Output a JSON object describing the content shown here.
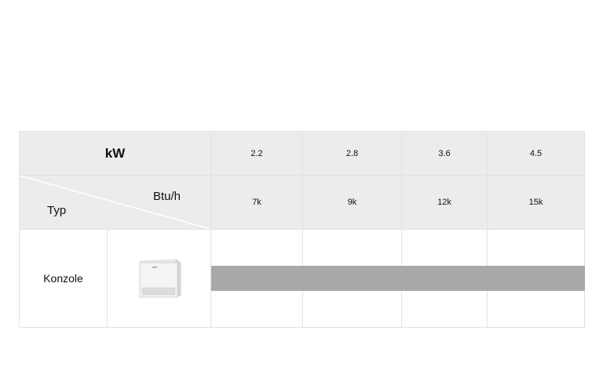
{
  "header": {
    "kw_label": "kW",
    "btu_label": "Btu/h",
    "type_label": "Typ",
    "kw_values": [
      "2.2",
      "2.8",
      "3.6",
      "4.5"
    ],
    "btu_values": [
      "7k",
      "9k",
      "12k",
      "15k"
    ]
  },
  "rows": [
    {
      "type": "Konzole",
      "image": "console-unit-icon"
    }
  ],
  "colors": {
    "header_bg": "#ececec",
    "bar": "#a9a9a9",
    "border": "#e2e2e2"
  }
}
